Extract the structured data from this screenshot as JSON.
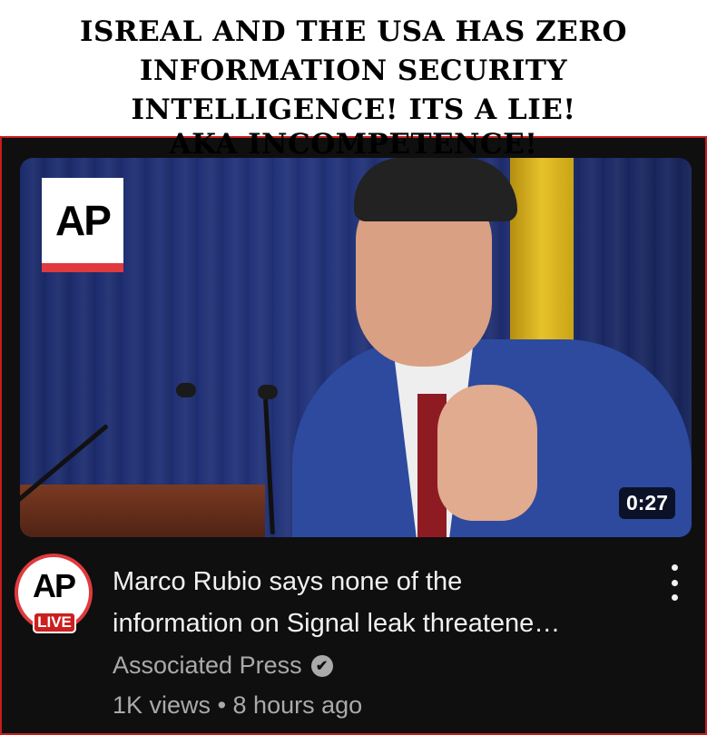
{
  "caption": {
    "lines": [
      "ISREAL AND THE USA HAS ZERO",
      "INFORMATION SECURITY",
      "INTELLIGENCE! ITS A LIE!",
      "AKA INCOMPETENCE!"
    ]
  },
  "video": {
    "thumbnail_logo": "AP",
    "duration": "0:27",
    "title_lines": [
      "Marco Rubio says none of the",
      "information on Signal leak threatene…"
    ],
    "channel_avatar_text": "AP",
    "live_badge": "LIVE",
    "channel": "Associated Press",
    "verified_icon": "✔",
    "views": "1K views",
    "separator": "•",
    "age": "8 hours ago"
  },
  "colors": {
    "accent_red": "#e03a3e",
    "card_background": "#0f0f0f",
    "secondary_text": "#aaaaaa"
  },
  "icons": [
    "verified-check-icon",
    "more-vert-icon"
  ]
}
